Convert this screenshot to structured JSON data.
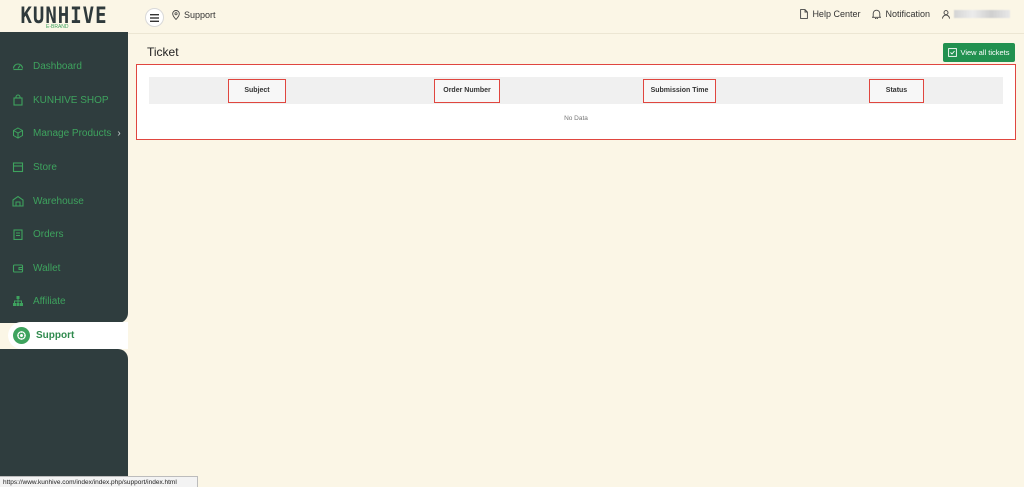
{
  "brand": {
    "logo_text": "KUNHIVE",
    "logo_sub": "E-BRAND"
  },
  "sidebar": {
    "items": [
      {
        "label": "Dashboard",
        "icon": "dashboard-icon"
      },
      {
        "label": "KUNHIVE SHOP",
        "icon": "shopping-bag-icon"
      },
      {
        "label": "Manage Products",
        "icon": "box-icon",
        "has_submenu": true
      },
      {
        "label": "Store",
        "icon": "store-icon"
      },
      {
        "label": "Warehouse",
        "icon": "warehouse-icon"
      },
      {
        "label": "Orders",
        "icon": "clipboard-icon"
      },
      {
        "label": "Wallet",
        "icon": "wallet-icon"
      },
      {
        "label": "Affiliate",
        "icon": "network-icon"
      }
    ],
    "active": {
      "label": "Support",
      "icon": "support-icon"
    }
  },
  "header": {
    "breadcrumb": "Support",
    "help_center": "Help Center",
    "notification": "Notification"
  },
  "page": {
    "title": "Ticket",
    "view_all_label": "View all tickets"
  },
  "table": {
    "columns": [
      "Subject",
      "Order Number",
      "Submission Time",
      "Status"
    ],
    "empty_text": "No Data"
  },
  "status_url": "https://www.kunhive.com/index/index.php/support/index.html",
  "colors": {
    "accent": "#229150",
    "sidebar": "#2f3d3e",
    "highlight": "#e0463f"
  }
}
